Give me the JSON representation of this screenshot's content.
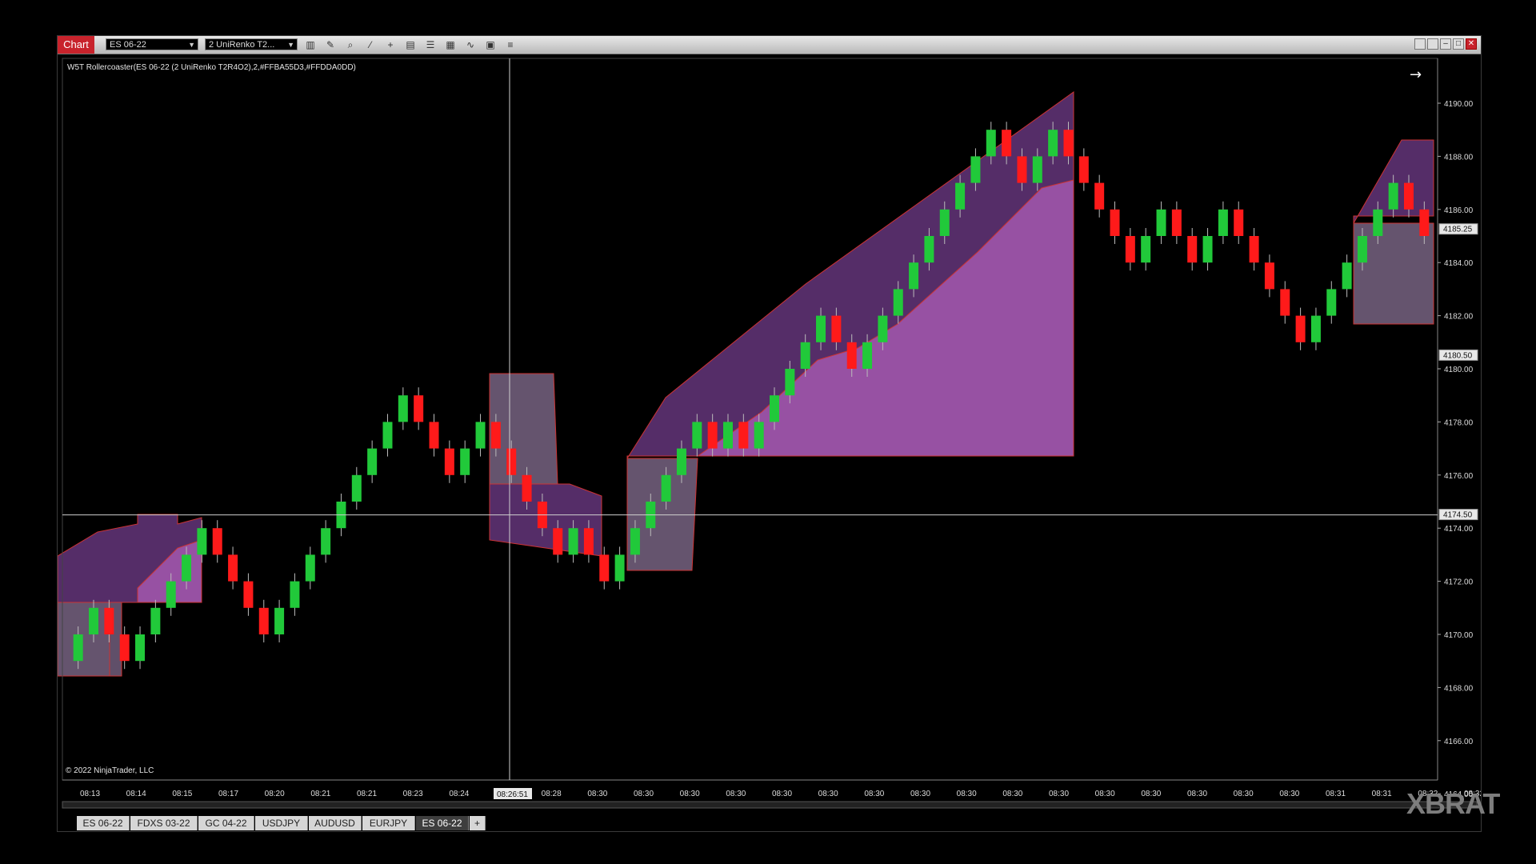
{
  "window": {
    "chart_label": "Chart",
    "instrument": "ES 06-22",
    "bar_type": "2 UniRenko T2...",
    "toolbar_icons": [
      "bar-type-icon",
      "draw-pencil-icon",
      "zoom-icon",
      "magic-wand-icon",
      "crosshair-icon",
      "properties-icon",
      "strategies-icon",
      "indicators-icon",
      "chart-trader-icon",
      "data-box-icon",
      "list-icon"
    ]
  },
  "chart": {
    "indicator_label": "W5T Rollercoaster(ES 06-22 (2 UniRenko T2R4O2),2,#FFBA55D3,#FFDDA0DD)",
    "copyright": "© 2022 NinjaTrader, LLC",
    "price_labels": [
      "4190.00",
      "4188.00",
      "4186.00",
      "4184.00",
      "4182.00",
      "4180.00",
      "4178.00",
      "4176.00",
      "4174.00",
      "4172.00",
      "4170.00",
      "4168.00",
      "4166.00",
      "4164.00"
    ],
    "current_price": "4185.25",
    "level_price": "4180.50",
    "crosshair_price": "4174.50",
    "crosshair_time": "08:26:51",
    "time_labels": [
      "08:13",
      "08:14",
      "08:15",
      "08:17",
      "08:20",
      "08:21",
      "08:21",
      "08:23",
      "08:24",
      "08:25",
      "08:28",
      "08:30",
      "08:30",
      "08:30",
      "08:30",
      "08:30",
      "08:30",
      "08:30",
      "08:30",
      "08:30",
      "08:30",
      "08:30",
      "08:30",
      "08:30",
      "08:30",
      "08:30",
      "08:30",
      "08:31",
      "08:31",
      "08:32",
      "08:32"
    ],
    "colors": {
      "up": "#21c93a",
      "down": "#ff1a1a",
      "band_dark": "#5a2f6e",
      "band_light": "#9b53a6",
      "grey_band": "#6a5874",
      "crosshair": "#cfcfcf"
    }
  },
  "tabs": [
    "ES 06-22",
    "FDXS 03-22",
    "GC 04-22",
    "USDJPY",
    "AUDUSD",
    "EURJPY",
    "ES 06-22"
  ],
  "active_tab_index": 6,
  "add_tab": "+",
  "watermark": "XBRAT",
  "chart_data": {
    "type": "candlestick",
    "ylim": [
      4163.5,
      4190.5
    ],
    "brick_size": 0.5,
    "brick_path": [
      4169,
      4170,
      4171,
      4170,
      4169,
      4170,
      4171,
      4172,
      4173,
      4174,
      4173,
      4172,
      4171,
      4170,
      4171,
      4172,
      4173,
      4174,
      4175,
      4176,
      4177,
      4178,
      4179,
      4178,
      4177,
      4176,
      4177,
      4178,
      4177,
      4176,
      4175,
      4174,
      4173,
      4174,
      4173,
      4172,
      4173,
      4174,
      4175,
      4176,
      4177,
      4178,
      4177,
      4178,
      4177,
      4178,
      4179,
      4180,
      4181,
      4182,
      4181,
      4180,
      4181,
      4182,
      4183,
      4184,
      4185,
      4186,
      4187,
      4188,
      4189,
      4188,
      4187,
      4188,
      4189,
      4188,
      4187,
      4186,
      4185,
      4184,
      4185,
      4186,
      4185,
      4184,
      4185,
      4186,
      4185,
      4184,
      4183,
      4182,
      4181,
      4182,
      4183,
      4184,
      4185,
      4186,
      4187,
      4186,
      4185
    ]
  }
}
